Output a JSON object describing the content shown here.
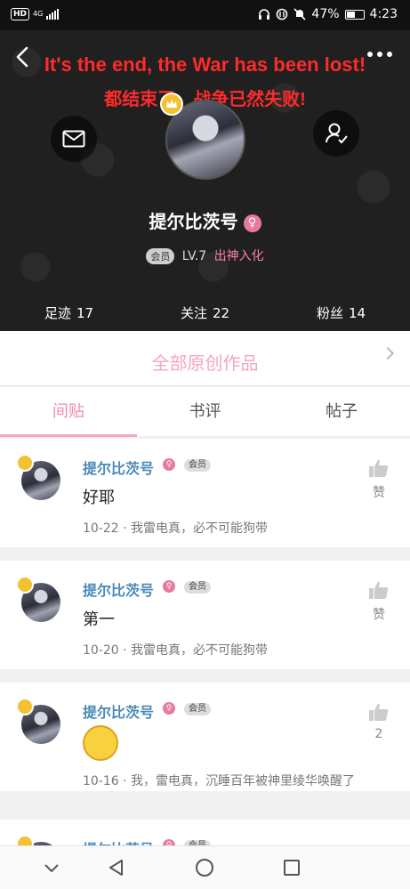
{
  "status_bar": {
    "network": "HD",
    "signal": "4G",
    "battery": "47%",
    "time": "4:23"
  },
  "header": {
    "caption_en": "It's the end, the War has been lost!",
    "caption_zh": "都结束了，战争已然失败!",
    "nickname": "提尔比茨号",
    "vip_tag": "会员",
    "level": "LV.7",
    "rank": "出神入化",
    "stats": [
      {
        "label": "足迹",
        "value": "17"
      },
      {
        "label": "关注",
        "value": "22"
      },
      {
        "label": "粉丝",
        "value": "14"
      }
    ]
  },
  "works_bar": {
    "title": "全部原创作品"
  },
  "tabs": [
    "间贴",
    "书评",
    "帖子"
  ],
  "posts": [
    {
      "author": "提尔比茨号",
      "vip": "会员",
      "content": "好耶",
      "date": "10-22",
      "source": "我雷电真，必不可能狗带",
      "like": "赞"
    },
    {
      "author": "提尔比茨号",
      "vip": "会员",
      "content": "第一",
      "date": "10-20",
      "source": "我雷电真，必不可能狗带",
      "like": "赞"
    },
    {
      "author": "提尔比茨号",
      "vip": "会员",
      "content": "",
      "date": "10-16",
      "source": "我，雷电真，沉睡百年被神里绫华唤醒了",
      "like": "2"
    },
    {
      "author": "提尔比茨号",
      "vip": "会员"
    }
  ],
  "colors": {
    "accent_pink": "#f4a6bd",
    "name_blue": "#4a8ab8",
    "caption_red": "#ff2a2a",
    "crown_gold": "#f2c230"
  },
  "icons": [
    "back-icon",
    "more-icon",
    "mail-icon",
    "follow-user-icon",
    "female-icon",
    "crown-icon",
    "thumbs-up-icon",
    "chevron-right-icon",
    "nav-back-icon",
    "nav-home-icon",
    "nav-recents-icon",
    "nav-collapse-icon"
  ]
}
